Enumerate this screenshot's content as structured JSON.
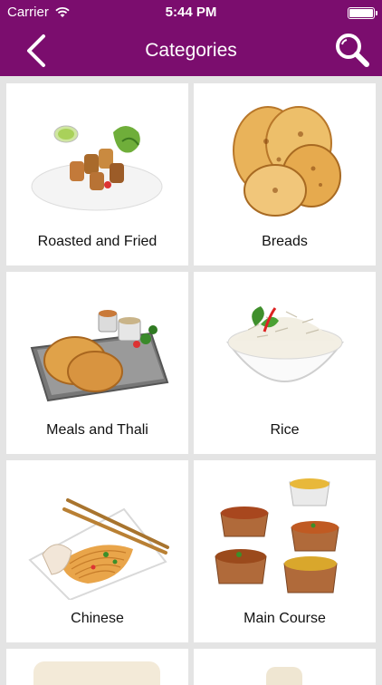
{
  "status": {
    "carrier": "Carrier",
    "time": "5:44 PM"
  },
  "nav": {
    "title": "Categories"
  },
  "categories": [
    {
      "label": "Roasted and Fried"
    },
    {
      "label": "Breads"
    },
    {
      "label": "Meals and Thali"
    },
    {
      "label": "Rice"
    },
    {
      "label": "Chinese"
    },
    {
      "label": "Main Course"
    }
  ],
  "colors": {
    "brand": "#7b0d6e",
    "background": "#e4e4e4"
  }
}
